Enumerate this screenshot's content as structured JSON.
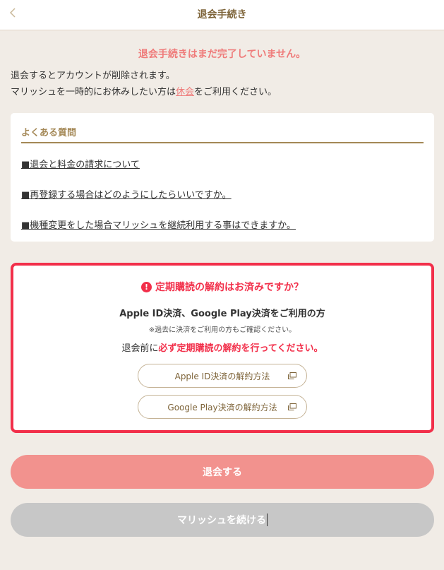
{
  "header": {
    "title": "退会手続き",
    "back_icon": "chevron-left-icon"
  },
  "warning": "退会手続きはまだ完了していません。",
  "notice": {
    "line1": "退会するとアカウントが削除されます。",
    "line2_before": "マリッシュを一時的にお休みしたい方は",
    "line2_link": "休会",
    "line2_after": "をご利用ください。"
  },
  "faq": {
    "title": "よくある質問",
    "items": [
      "■退会と料金の請求について",
      "■再登録する場合はどのようにしたらいいですか。",
      "■機種変更をした場合マリッシュを継続利用する事はできますか。"
    ]
  },
  "subscription": {
    "heading": "定期購読の解約はお済みですか？",
    "alert_icon": "exclamation-circle-icon",
    "methods": "Apple ID決済、Google Play決済をご利用の方",
    "note": "※過去に決済をご利用の方もご確認ください。",
    "must_before": "退会前に",
    "must_emphasis": "必ず定期購読の解約を行ってください。",
    "apple_button": "Apple ID決済の解約方法",
    "google_button": "Google Play決済の解約方法",
    "external_icon": "external-window-icon"
  },
  "actions": {
    "withdraw": "退会する",
    "continue": "マリッシュを続ける"
  },
  "colors": {
    "accent_red": "#f22f4a",
    "salmon": "#ef7b7a",
    "gold": "#a48856",
    "brown": "#7d6338",
    "withdraw_bg": "#f2928e",
    "continue_bg": "#c7c7c7",
    "page_bg": "#f1ece6"
  }
}
